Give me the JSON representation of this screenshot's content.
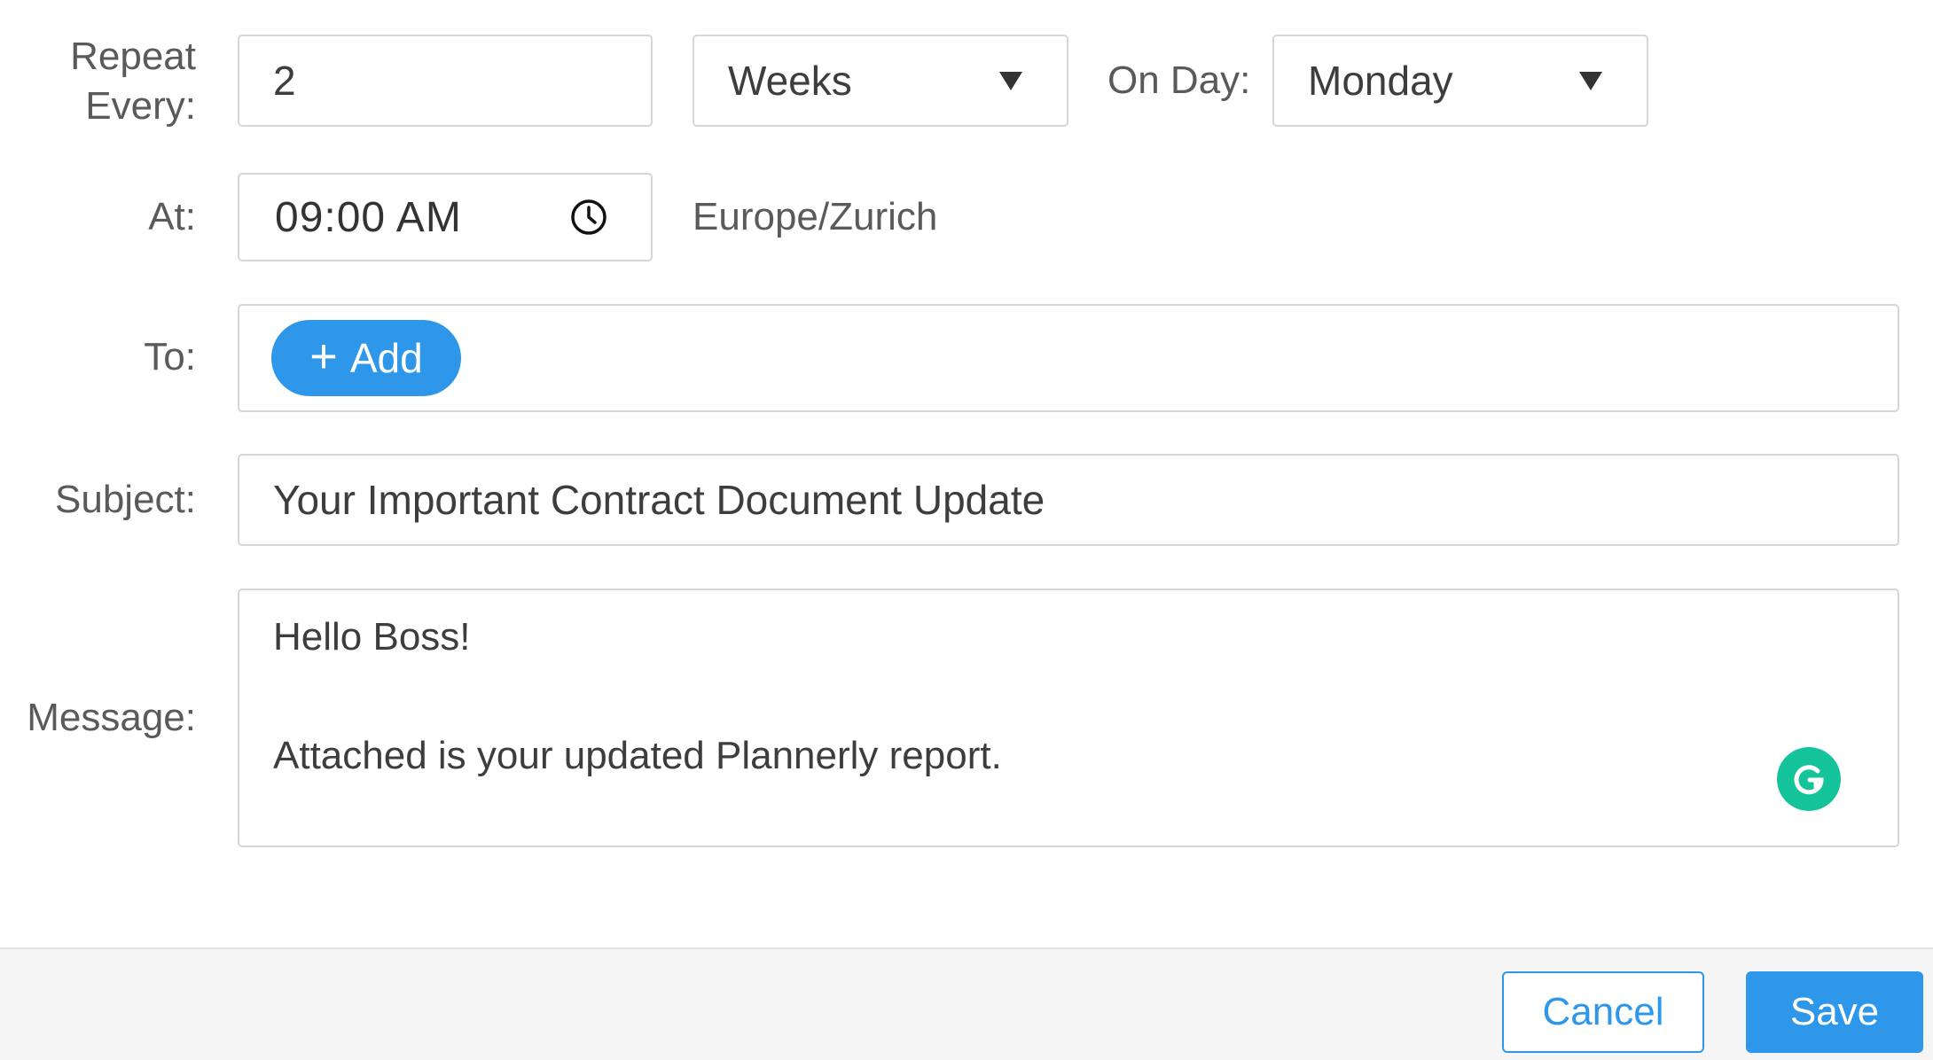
{
  "repeat": {
    "label_line1": "Repeat",
    "label_line2": "Every:",
    "interval_value": "2",
    "unit_selected": "Weeks",
    "on_day_label": "On Day:",
    "day_selected": "Monday"
  },
  "time": {
    "label": "At:",
    "value": "09:00 AM",
    "timezone": "Europe/Zurich"
  },
  "recipients": {
    "label": "To:",
    "add_label": "Add"
  },
  "subject": {
    "label": "Subject:",
    "value": "Your Important Contract Document Update"
  },
  "message": {
    "label": "Message:",
    "line1": "Hello Boss!",
    "line2": "Attached is your updated Plannerly report."
  },
  "footer": {
    "cancel_label": "Cancel",
    "save_label": "Save"
  },
  "colors": {
    "accent": "#2f97ea",
    "grammarly": "#15c39a",
    "border": "#d6d6d6"
  }
}
